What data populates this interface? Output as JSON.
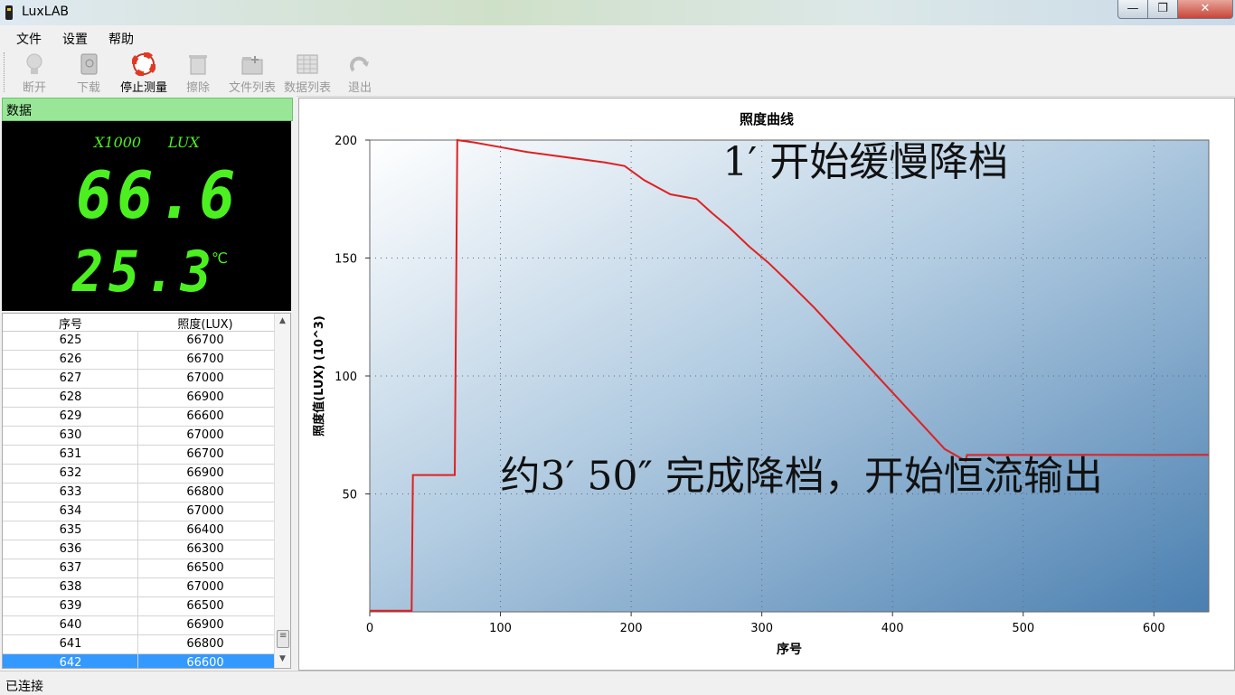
{
  "window": {
    "title": "LuxLAB",
    "min": "—",
    "max": "❐",
    "close": "✕"
  },
  "menu": [
    "文件",
    "设置",
    "帮助"
  ],
  "toolbar": [
    {
      "label": "断开",
      "icon": "bulb-icon",
      "enabled": false
    },
    {
      "label": "下载",
      "icon": "download-book-icon",
      "enabled": false
    },
    {
      "label": "停止测量",
      "icon": "lifebuoy-icon",
      "enabled": true
    },
    {
      "label": "擦除",
      "icon": "erase-icon",
      "enabled": false
    },
    {
      "label": "文件列表",
      "icon": "file-list-icon",
      "enabled": false
    },
    {
      "label": "数据列表",
      "icon": "data-list-icon",
      "enabled": false
    },
    {
      "label": "退出",
      "icon": "exit-arrow-icon",
      "enabled": false
    }
  ],
  "panel": {
    "title": "数据",
    "lcd": {
      "scale": "X1000",
      "unit": "LUX",
      "value": "66.6",
      "temperature": "25.3",
      "temp_unit": "℃",
      "color": "#4cf020"
    }
  },
  "table": {
    "headers": [
      "序号",
      "照度(LUX)"
    ],
    "rows": [
      [
        "625",
        "66700"
      ],
      [
        "626",
        "66700"
      ],
      [
        "627",
        "67000"
      ],
      [
        "628",
        "66900"
      ],
      [
        "629",
        "66600"
      ],
      [
        "630",
        "67000"
      ],
      [
        "631",
        "66700"
      ],
      [
        "632",
        "66900"
      ],
      [
        "633",
        "66800"
      ],
      [
        "634",
        "67000"
      ],
      [
        "635",
        "66400"
      ],
      [
        "636",
        "66300"
      ],
      [
        "637",
        "66500"
      ],
      [
        "638",
        "67000"
      ],
      [
        "639",
        "66500"
      ],
      [
        "640",
        "66900"
      ],
      [
        "641",
        "66800"
      ],
      [
        "642",
        "66600"
      ]
    ],
    "selected_row": "642"
  },
  "chart_data": {
    "type": "line",
    "title": "照度曲线",
    "xlabel": "序号",
    "ylabel": "照度值(LUX)  (10^3)",
    "xlim": [
      0,
      642
    ],
    "ylim": [
      0,
      200
    ],
    "xticks": [
      "0",
      "100",
      "200",
      "300",
      "400",
      "500",
      "600"
    ],
    "yticks": [
      "50",
      "100",
      "150",
      "200"
    ],
    "grid": true,
    "line_color": "#e02020",
    "series": [
      {
        "x": [
          0,
          32,
          33,
          65,
          67,
          80,
          100,
          120,
          140,
          160,
          180,
          195,
          210,
          230,
          250,
          262,
          275,
          290,
          305,
          320,
          340,
          360,
          380,
          400,
          420,
          440,
          456,
          457,
          500,
          550,
          600,
          642
        ],
        "y": [
          0.5,
          0.5,
          58,
          58,
          200,
          199,
          197,
          195,
          193.5,
          192,
          190.5,
          189,
          183,
          177,
          175,
          169,
          163,
          155,
          148,
          140,
          129,
          117,
          105,
          93,
          81,
          69,
          64,
          66.5,
          66.5,
          66.6,
          66.5,
          66.6
        ]
      }
    ],
    "annotations": [
      {
        "text": "1′ 开始缓慢降档",
        "x": 270,
        "y": 185
      },
      {
        "text": "约3′ 50″ 完成降档，开始恒流输出",
        "x": 100,
        "y": 52
      }
    ]
  },
  "status": "已连接"
}
